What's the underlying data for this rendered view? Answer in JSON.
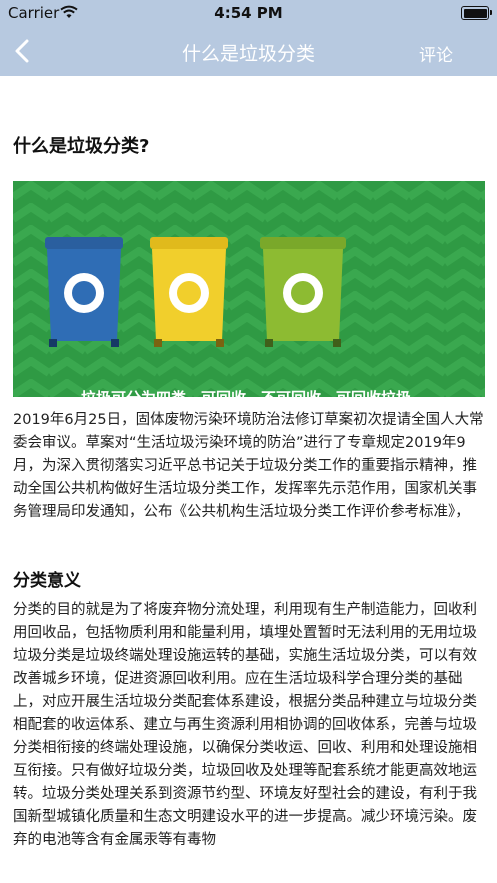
{
  "status_bar": {
    "carrier": "Carrier",
    "time": "4:54 PM"
  },
  "nav": {
    "title": "什么是垃圾分类",
    "comment_label": "评论"
  },
  "article": {
    "title": "什么是垃圾分类?",
    "banner_caption": "垃圾可分为四类　可回收　不可回收　可回收垃圾",
    "paragraph1": "2019年6月25日，固体废物污染环境防治法修订草案初次提请全国人大常委会审议。草案对“生活垃圾污染环境的防治”进行了专章规定2019年9月，为深入贯彻落实习近平总书记关于垃圾分类工作的重要指示精神，推动全国公共机构做好生活垃圾分类工作，发挥率先示范作用，国家机关事务管理局印发通知，公布《公共机构生活垃圾分类工作评价参考标准》，",
    "section_heading": "分类意义",
    "paragraph2": "分类的目的就是为了将废弃物分流处理，利用现有生产制造能力，回收利用回收品，包括物质利用和能量利用，填埋处置暂时无法利用的无用垃圾垃圾分类是垃圾终端处理设施运转的基础，实施生活垃圾分类，可以有效改善城乡环境，促进资源回收利用。应在生活垃圾科学合理分类的基础上，对应开展生活垃圾分类配套体系建设，根据分类品种建立与垃圾分类相配套的收运体系、建立与再生资源利用相协调的回收体系，完善与垃圾分类相衔接的终端处理设施，以确保分类收运、回收、利用和处理设施相互衔接。只有做好垃圾分类，垃圾回收及处理等配套系统才能更高效地运转。垃圾分类处理关系到资源节约型、环境友好型社会的建设，有利于我国新型城镇化质量和生态文明建设水平的进一步提高。减少环境污染。废弃的电池等含有金属汞等有毒物"
  },
  "colors": {
    "nav_bg": "#b7c9e0",
    "banner_green": "#2f9a44",
    "bin_blue": "#2f6db5",
    "bin_yellow": "#f1cf2c",
    "bin_green": "#8dbb32"
  },
  "icons": {
    "back": "chevron-left-icon",
    "wifi": "wifi-icon",
    "battery": "battery-icon",
    "recycle": "recycle-icon"
  }
}
